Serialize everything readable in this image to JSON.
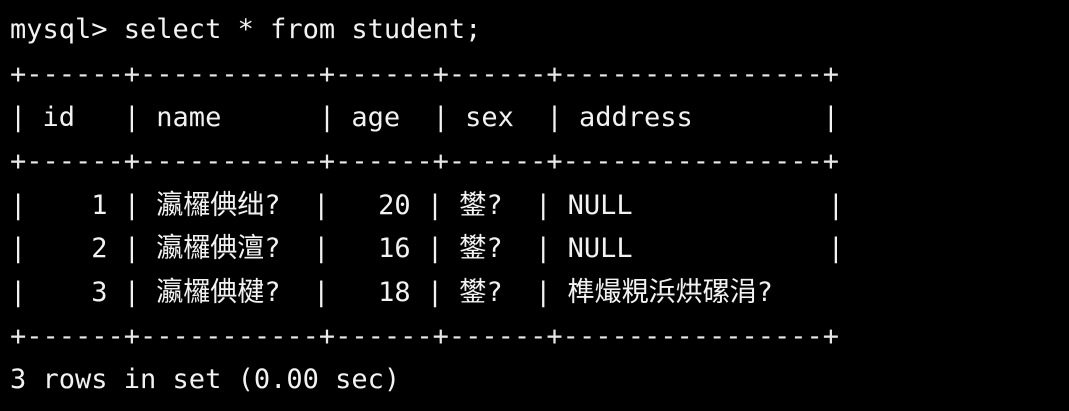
{
  "prompt_line": "mysql> select * from student;",
  "separator_line": "+------+-----------+------+------+----------------+",
  "header_line": "| id   | name      | age  | sex  | address        |",
  "rows": [
    "|    1 | 瀛欏倎绌?  |   20 | 鐢?  | NULL            |",
    "|    2 | 瀛欏倎澶?  |   16 | 鐢?  | NULL            |",
    "|    3 | 瀛欏倎楗?  |   18 | 鐢?  | 榫熶粯浜烘磥涓?"
  ],
  "footer_line": "3 rows in set (0.00 sec)",
  "colors": {
    "background": "#000000",
    "text": "#f2f2f2"
  }
}
